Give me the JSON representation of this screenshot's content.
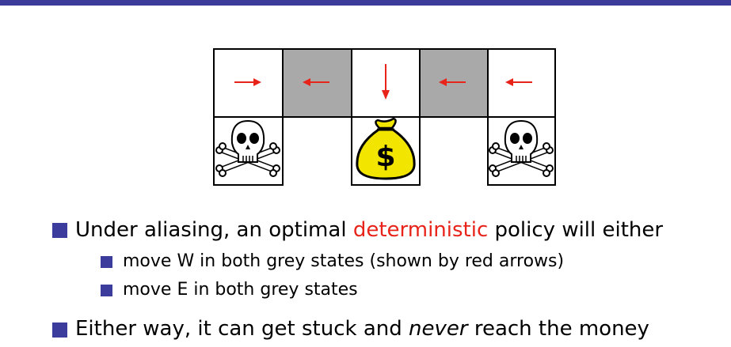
{
  "bullets": {
    "b1": {
      "pre": "Under aliasing, an optimal ",
      "highlight": "deterministic",
      "post": " policy will either"
    },
    "sub1": "move W in both grey states (shown by red arrows)",
    "sub2": "move E in both grey states",
    "b2": {
      "pre": "Either way, it can get stuck and ",
      "emph": "never",
      "post": " reach the money"
    }
  },
  "colors": {
    "accent": "#3c3c9c",
    "arrow": "#e8231a",
    "grey_state": "#a9a9a9",
    "money_bag": "#f2e600"
  },
  "icons": [
    "right-arrow-icon",
    "left-arrow-icon",
    "down-arrow-icon",
    "skull-crossbones-icon",
    "money-bag-icon"
  ]
}
